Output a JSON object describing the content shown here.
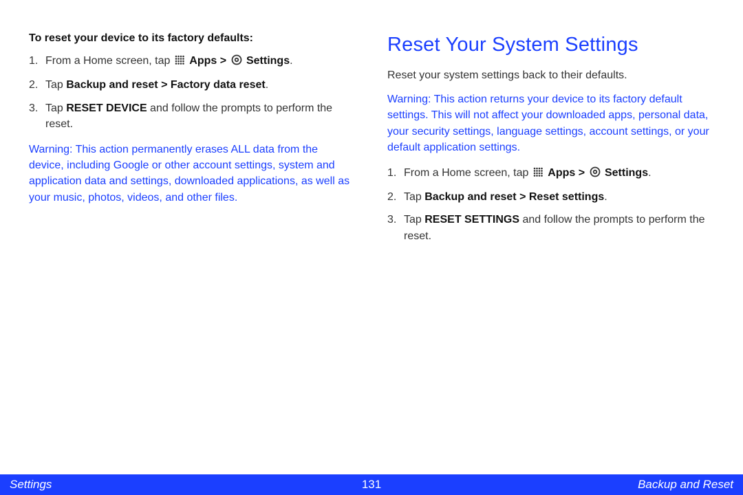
{
  "left": {
    "subhead": "To reset your device to its factory defaults:",
    "steps": {
      "s1_pre": "From a Home screen, tap ",
      "s1_apps": "Apps > ",
      "s1_settings": "Settings",
      "s2_pre": "Tap ",
      "s2_bold": "Backup and reset > Factory data reset",
      "s3_pre": "Tap ",
      "s3_bold": "RESET DEVICE",
      "s3_post": " and follow the prompts to perform the reset."
    },
    "warning_label": "Warning",
    "warning_text": ": This action permanently erases ALL data from the device, including Google or other account settings, system and application data and settings, downloaded applications, as well as your music, photos, videos, and other files."
  },
  "right": {
    "title": "Reset Your System Settings",
    "intro": "Reset your system settings back to their defaults.",
    "warning_label": "Warning",
    "warning_text": ": This action returns your device to its factory default settings. This will not affect your downloaded apps, personal data, your security settings, language settings, account settings, or your default application settings.",
    "steps": {
      "s1_pre": "From a Home screen, tap ",
      "s1_apps": "Apps > ",
      "s1_settings": "Settings",
      "s2_pre": "Tap ",
      "s2_bold": "Backup and reset > Reset settings",
      "s3_pre": "Tap ",
      "s3_bold": "RESET SETTINGS",
      "s3_post": " and follow the prompts to perform the reset."
    }
  },
  "footer": {
    "left": "Settings",
    "center": "131",
    "right": "Backup and Reset"
  }
}
